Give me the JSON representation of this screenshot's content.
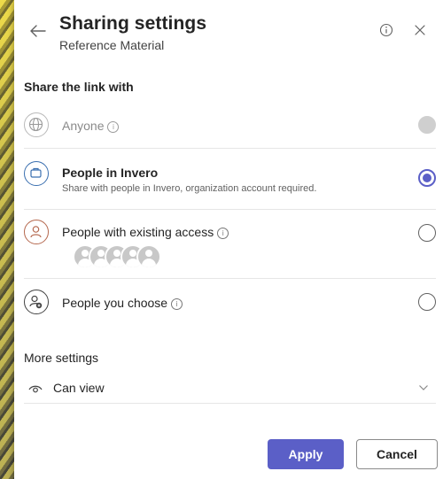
{
  "header": {
    "title": "Sharing settings",
    "subtitle": "Reference Material"
  },
  "share_section": {
    "label": "Share the link with",
    "options": [
      {
        "label": "Anyone",
        "icon": "globe-icon",
        "state": "disabled",
        "has_info": true
      },
      {
        "label": "People in Invero",
        "description": "Share with people in Invero, organization account required.",
        "icon": "organization-icon",
        "state": "selected",
        "has_info": false
      },
      {
        "label": "People with existing access",
        "icon": "people-access-icon",
        "state": "unselected",
        "has_info": true
      },
      {
        "label": "People you choose",
        "icon": "person-add-icon",
        "state": "unselected",
        "has_info": true
      }
    ]
  },
  "more_settings": {
    "label": "More settings",
    "permission": {
      "icon": "eye-icon",
      "value": "Can view"
    }
  },
  "buttons": {
    "apply": "Apply",
    "cancel": "Cancel"
  },
  "colors": {
    "accent": "#5b5fc7",
    "org_icon_border": "#3a6fb0",
    "access_icon_border": "#b5694f"
  }
}
